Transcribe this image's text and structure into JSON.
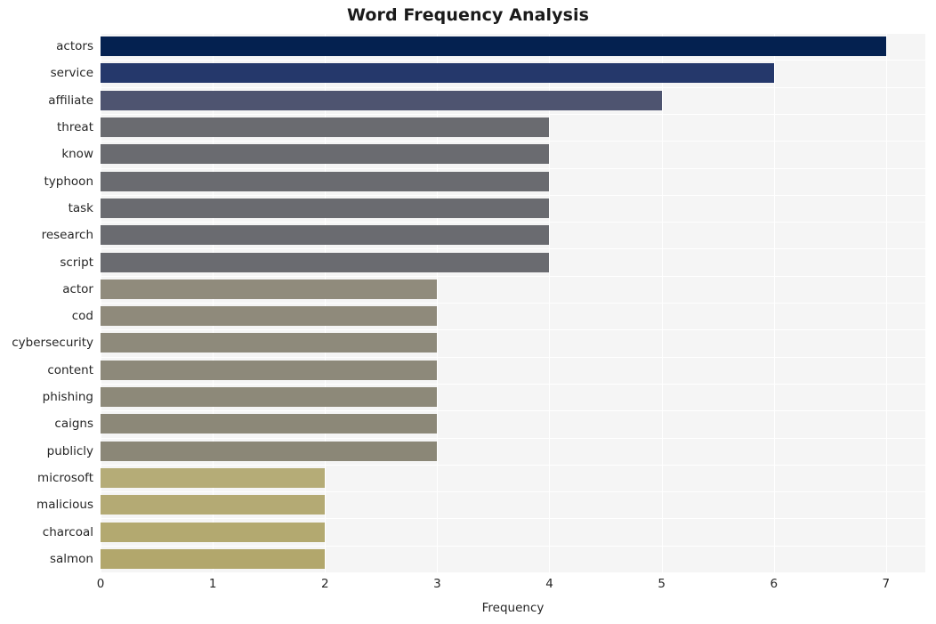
{
  "chart_data": {
    "type": "bar",
    "orientation": "horizontal",
    "title": "Word Frequency Analysis",
    "xlabel": "Frequency",
    "ylabel": "",
    "xlim": [
      0,
      7.35
    ],
    "xticks": [
      0,
      1,
      2,
      3,
      4,
      5,
      6,
      7
    ],
    "xticklabels": [
      "0",
      "1",
      "2",
      "3",
      "4",
      "5",
      "6",
      "7"
    ],
    "grid": true,
    "grid_color": "#ffffff",
    "plot_background": "#f5f5f5",
    "figure_background": "#ffffff",
    "legend": "none",
    "categories": [
      "actors",
      "service",
      "affiliate",
      "threat",
      "know",
      "typhoon",
      "task",
      "research",
      "script",
      "actor",
      "cod",
      "cybersecurity",
      "content",
      "phishing",
      "caigns",
      "publicly",
      "microsoft",
      "malicious",
      "charcoal",
      "salmon"
    ],
    "values": [
      7,
      6,
      5,
      4,
      4,
      4,
      4,
      4,
      4,
      3,
      3,
      3,
      3,
      3,
      3,
      3,
      2,
      2,
      2,
      2
    ],
    "bar_colors": [
      "#042150",
      "#25386b",
      "#4e5470",
      "#6a6b70",
      "#6a6b70",
      "#6a6b70",
      "#6a6b70",
      "#6a6b70",
      "#6a6b70",
      "#908b7c",
      "#8f8a7b",
      "#8e8a7b",
      "#8d897a",
      "#8d8979",
      "#8c8878",
      "#8b8777",
      "#b5ac77",
      "#b4aa74",
      "#b3a970",
      "#b2a76c"
    ]
  },
  "axis": {
    "title": "Word Frequency Analysis",
    "xlabel": "Frequency"
  }
}
